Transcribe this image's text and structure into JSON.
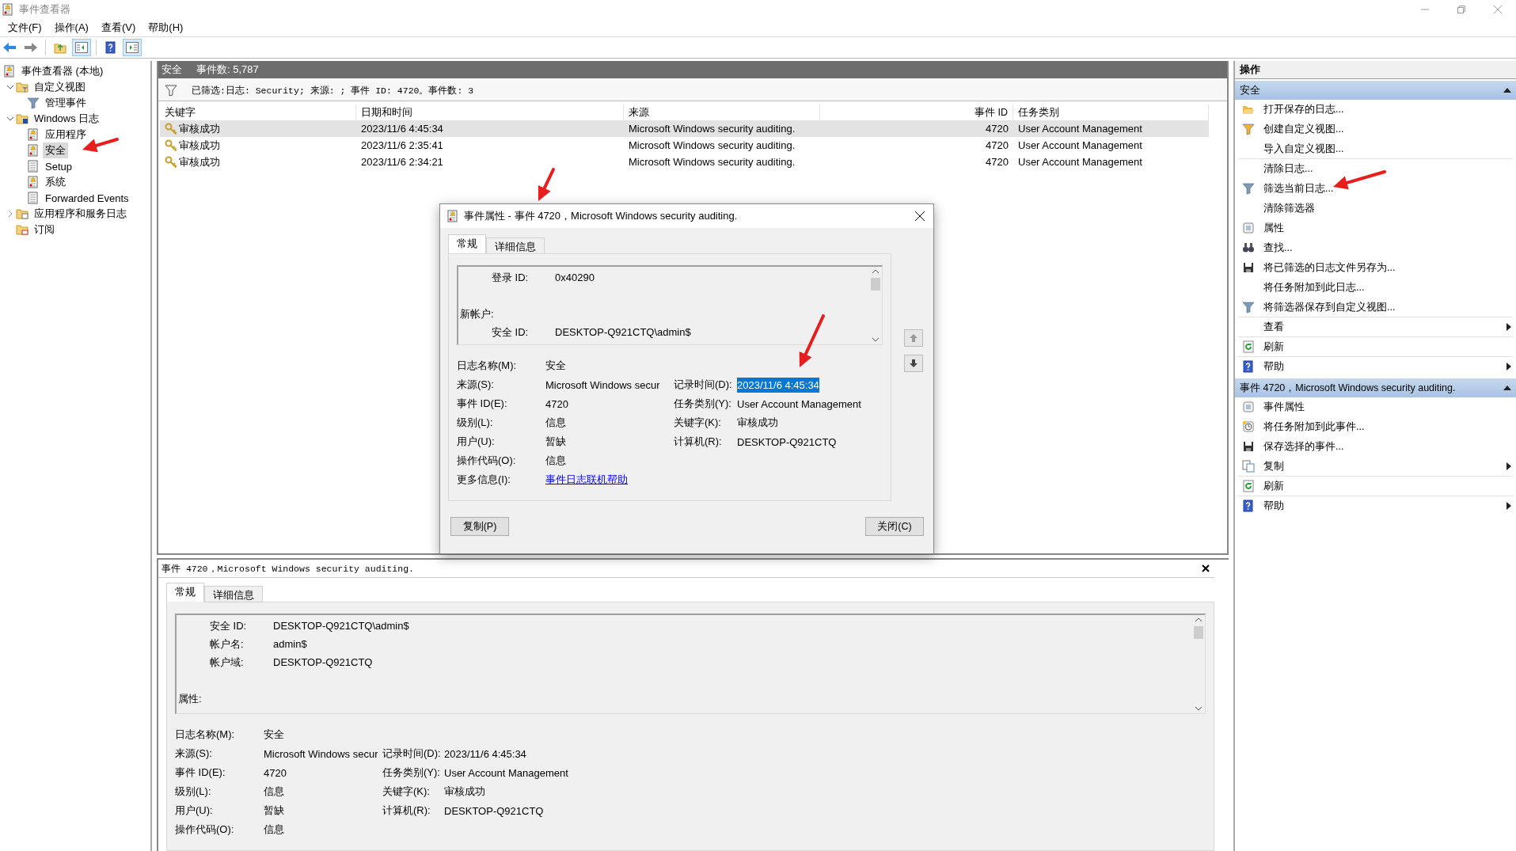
{
  "window": {
    "title": "事件查看器"
  },
  "menu": [
    "文件(F)",
    "操作(A)",
    "查看(V)",
    "帮助(H)"
  ],
  "tree": [
    {
      "label": "事件查看器 (本地)",
      "kind": "viewer",
      "selected": false,
      "children": [
        {
          "label": "自定义视图",
          "kind": "folder-filter",
          "expanded": true,
          "selected": false,
          "children": [
            {
              "label": "管理事件",
              "kind": "filter",
              "selected": false
            }
          ]
        },
        {
          "label": "Windows 日志",
          "kind": "folder-windows",
          "expanded": true,
          "selected": false,
          "children": [
            {
              "label": "应用程序",
              "kind": "log-warn",
              "selected": false
            },
            {
              "label": "安全",
              "kind": "log-warn",
              "selected": true
            },
            {
              "label": "Setup",
              "kind": "log",
              "selected": false
            },
            {
              "label": "系统",
              "kind": "log-warn",
              "selected": false
            },
            {
              "label": "Forwarded Events",
              "kind": "log",
              "selected": false
            }
          ]
        },
        {
          "label": "应用程序和服务日志",
          "kind": "folder",
          "expanded": false,
          "selected": false
        },
        {
          "label": "订阅",
          "kind": "folder-sub",
          "selected": false
        }
      ]
    }
  ],
  "log_header": {
    "title": "安全",
    "count": "事件数: 5,787"
  },
  "filter_text": "已筛选:日志: Security; 来源: ; 事件 ID: 4720。事件数: 3",
  "table": {
    "columns": [
      "关键字",
      "日期和时间",
      "来源",
      "事件 ID",
      "任务类别"
    ],
    "rows": [
      {
        "selected": true,
        "cells": [
          "审核成功",
          "2023/11/6 4:45:34",
          "Microsoft Windows security auditing.",
          "4720",
          "User Account Management"
        ]
      },
      {
        "selected": false,
        "cells": [
          "审核成功",
          "2023/11/6 2:35:41",
          "Microsoft Windows security auditing.",
          "4720",
          "User Account Management"
        ]
      },
      {
        "selected": false,
        "cells": [
          "审核成功",
          "2023/11/6 2:34:21",
          "Microsoft Windows security auditing.",
          "4720",
          "User Account Management"
        ]
      }
    ]
  },
  "dialog": {
    "title": "事件属性 - 事件 4720，Microsoft Windows security auditing.",
    "tabs": [
      {
        "label": "常规",
        "selected": true
      },
      {
        "label": "详细信息",
        "selected": false
      }
    ],
    "message": [
      {
        "kind": "field",
        "label": "登录 ID:",
        "value": "0x40290"
      },
      {
        "kind": "blank"
      },
      {
        "kind": "heading",
        "label": "新帐户:"
      },
      {
        "kind": "field",
        "label": "安全 ID:",
        "value": "DESKTOP-Q921CTQ\\admin$"
      }
    ],
    "fields": [
      {
        "label": "日志名称(M):",
        "value": "安全"
      },
      {
        "label": "来源(S):",
        "value": "Microsoft Windows secur",
        "label2": "记录时间(D):",
        "value2": "2023/11/6 4:45:34",
        "highlighted": true
      },
      {
        "label": "事件 ID(E):",
        "value": "4720",
        "label2": "任务类别(Y):",
        "value2": "User Account Management"
      },
      {
        "label": "级别(L):",
        "value": "信息",
        "label2": "关键字(K):",
        "value2": "审核成功"
      },
      {
        "label": "用户(U):",
        "value": "暂缺",
        "label2": "计算机(R):",
        "value2": "DESKTOP-Q921CTQ"
      },
      {
        "label": "操作代码(O):",
        "value": "信息"
      },
      {
        "label": "更多信息(I):",
        "value": "事件日志联机帮助",
        "kind": "link"
      }
    ],
    "buttons": [
      "复制(P)",
      "关闭(C)"
    ]
  },
  "preview": {
    "title": "事件 4720，Microsoft Windows security auditing.",
    "tabs": [
      {
        "label": "常规",
        "selected": true
      },
      {
        "label": "详细信息",
        "selected": false
      }
    ],
    "message": [
      {
        "kind": "field",
        "label": "安全 ID:",
        "value": "DESKTOP-Q921CTQ\\admin$"
      },
      {
        "kind": "field",
        "label": "帐户名:",
        "value": "admin$"
      },
      {
        "kind": "field",
        "label": "帐户域:",
        "value": "DESKTOP-Q921CTQ"
      },
      {
        "kind": "blank"
      },
      {
        "kind": "heading",
        "label": "属性:"
      }
    ],
    "fields": [
      {
        "label": "日志名称(M):",
        "value": "安全"
      },
      {
        "label": "来源(S):",
        "value": "Microsoft Windows secur",
        "label2": "记录时间(D):",
        "value2": "2023/11/6 4:45:34"
      },
      {
        "label": "事件 ID(E):",
        "value": "4720",
        "label2": "任务类别(Y):",
        "value2": "User Account Management"
      },
      {
        "label": "级别(L):",
        "value": "信息",
        "label2": "关键字(K):",
        "value2": "审核成功"
      },
      {
        "label": "用户(U):",
        "value": "暂缺",
        "label2": "计算机(R):",
        "value2": "DESKTOP-Q921CTQ"
      },
      {
        "label": "操作代码(O):",
        "value": "信息"
      }
    ]
  },
  "actions": {
    "title": "操作",
    "sections": [
      {
        "title": "安全",
        "expanded": true,
        "items": [
          {
            "label": "打开保存的日志...",
            "kind": "folder-open",
            "submenu": false,
            "divider": false
          },
          {
            "label": "创建自定义视图...",
            "kind": "filter-new",
            "submenu": false,
            "divider": false
          },
          {
            "label": "导入自定义视图...",
            "kind": "plain",
            "submenu": false,
            "divider": true
          },
          {
            "label": "清除日志...",
            "kind": "plain",
            "submenu": false,
            "divider": false
          },
          {
            "label": "筛选当前日志...",
            "kind": "filter",
            "submenu": false,
            "divider": false
          },
          {
            "label": "清除筛选器",
            "kind": "plain",
            "submenu": false,
            "divider": false
          },
          {
            "label": "属性",
            "kind": "properties",
            "submenu": false,
            "divider": false
          },
          {
            "label": "查找...",
            "kind": "find",
            "submenu": false,
            "divider": false
          },
          {
            "label": "将已筛选的日志文件另存为...",
            "kind": "save",
            "submenu": false,
            "divider": false
          },
          {
            "label": "将任务附加到此日志...",
            "kind": "plain",
            "submenu": false,
            "divider": false
          },
          {
            "label": "将筛选器保存到自定义视图...",
            "kind": "filter-save",
            "submenu": false,
            "divider": true
          },
          {
            "label": "查看",
            "kind": "plain",
            "submenu": true,
            "divider": true
          },
          {
            "label": "刷新",
            "kind": "refresh",
            "submenu": false,
            "divider": true
          },
          {
            "label": "帮助",
            "kind": "help",
            "submenu": true,
            "divider": false
          }
        ]
      },
      {
        "title": "事件 4720，Microsoft Windows security auditing.",
        "expanded": true,
        "items": [
          {
            "label": "事件属性",
            "kind": "properties",
            "submenu": false,
            "divider": false
          },
          {
            "label": "将任务附加到此事件...",
            "kind": "task",
            "submenu": false,
            "divider": false
          },
          {
            "label": "保存选择的事件...",
            "kind": "save",
            "submenu": false,
            "divider": false
          },
          {
            "label": "复制",
            "kind": "copy",
            "submenu": true,
            "divider": true
          },
          {
            "label": "刷新",
            "kind": "refresh",
            "submenu": false,
            "divider": true
          },
          {
            "label": "帮助",
            "kind": "help",
            "submenu": true,
            "divider": false
          }
        ]
      }
    ]
  }
}
